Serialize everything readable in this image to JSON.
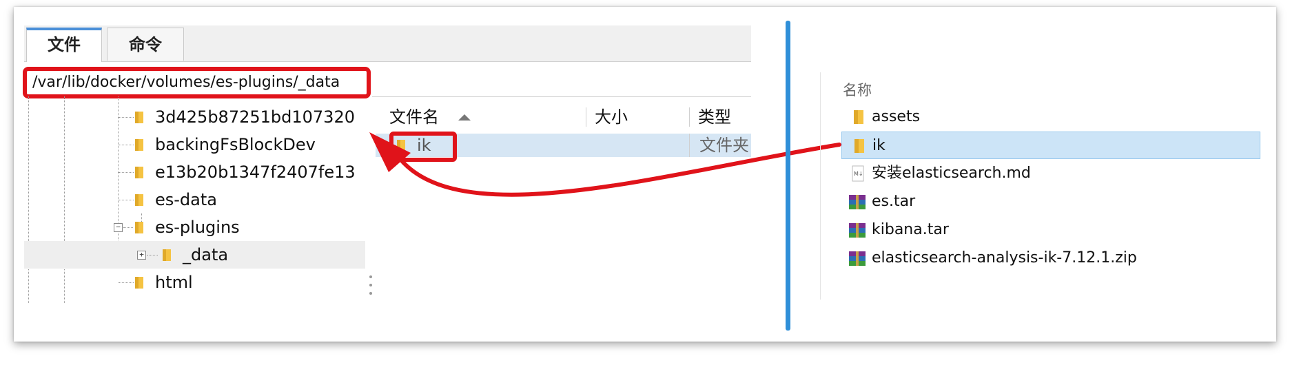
{
  "ftp_client": {
    "tabs": [
      {
        "label": "文件",
        "active": true
      },
      {
        "label": "命令",
        "active": false
      }
    ],
    "path": "/var/lib/docker/volumes/es-plugins/_data",
    "tree": [
      {
        "label": "3d425b87251bd107320"
      },
      {
        "label": "backingFsBlockDev"
      },
      {
        "label": "e13b20b1347f2407fe13"
      },
      {
        "label": "es-data"
      },
      {
        "label": "es-plugins",
        "expanded": true
      },
      {
        "label": "_data",
        "selected": true
      },
      {
        "label": "html"
      }
    ],
    "file_list": {
      "columns": [
        "文件名",
        "大小",
        "类型"
      ],
      "rows": [
        {
          "name": "ik",
          "size": "",
          "type": "文件夹"
        }
      ]
    }
  },
  "explorer": {
    "column_header": "名称",
    "items": [
      {
        "name": "assets",
        "icon": "folder-icon"
      },
      {
        "name": "ik",
        "icon": "folder-icon",
        "selected": true
      },
      {
        "name": "安装elasticsearch.md",
        "icon": "markdown-file-icon"
      },
      {
        "name": "es.tar",
        "icon": "winrar-archive-icon"
      },
      {
        "name": "kibana.tar",
        "icon": "winrar-archive-icon"
      },
      {
        "name": "elasticsearch-analysis-ik-7.12.1.zip",
        "icon": "winrar-archive-icon"
      }
    ]
  },
  "colors": {
    "highlight_red": "#e0131a",
    "divider_blue": "#2f8fd8",
    "folder_yellow": "#f5c342",
    "selection_blue": "#cce4f7"
  }
}
